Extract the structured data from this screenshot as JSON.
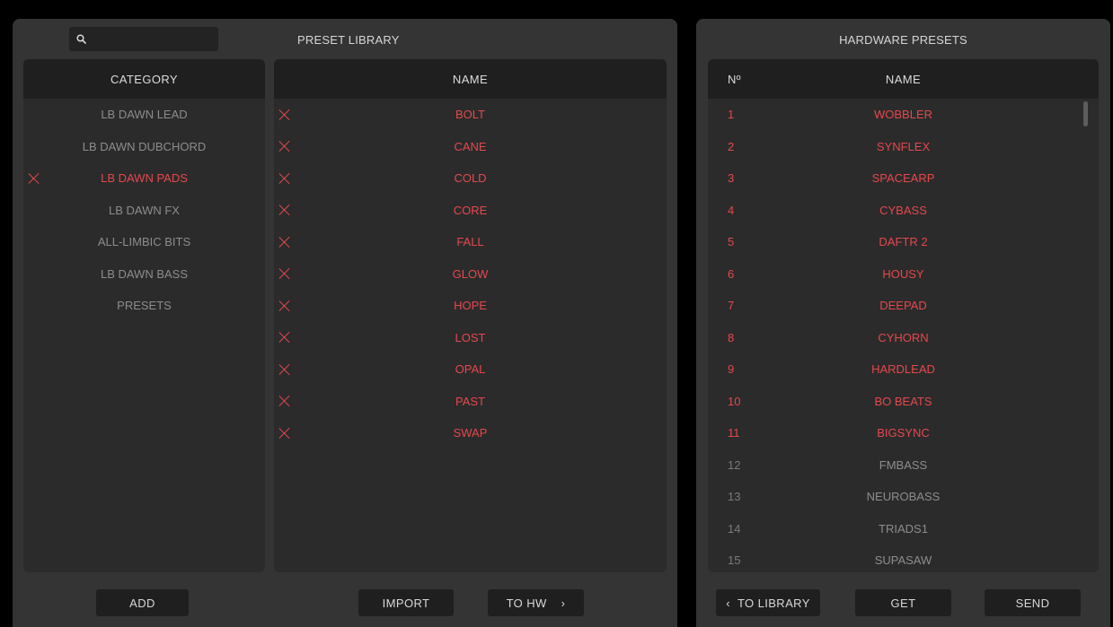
{
  "library": {
    "title": "PRESET LIBRARY",
    "search": {
      "value": "",
      "placeholder": ""
    },
    "category_header": "CATEGORY",
    "name_header": "NAME",
    "categories": [
      {
        "label": "LB DAWN LEAD",
        "selected": false
      },
      {
        "label": "LB DAWN DUBCHORD",
        "selected": false
      },
      {
        "label": "LB DAWN PADS",
        "selected": true
      },
      {
        "label": "LB DAWN FX",
        "selected": false
      },
      {
        "label": "ALL-LIMBIC BITS",
        "selected": false
      },
      {
        "label": "LB DAWN BASS",
        "selected": false
      },
      {
        "label": "PRESETS",
        "selected": false
      }
    ],
    "presets": [
      "BOLT",
      "CANE",
      "COLD",
      "CORE",
      "FALL",
      "GLOW",
      "HOPE",
      "LOST",
      "OPAL",
      "PAST",
      "SWAP"
    ],
    "buttons": {
      "add": "ADD",
      "import": "IMPORT",
      "to_hw": "TO HW"
    }
  },
  "hardware": {
    "title": "HARDWARE PRESETS",
    "num_header": "Nº",
    "name_header": "NAME",
    "presets": [
      {
        "num": "1",
        "name": "WOBBLER",
        "active": true
      },
      {
        "num": "2",
        "name": "SYNFLEX",
        "active": true
      },
      {
        "num": "3",
        "name": "SPACEARP",
        "active": true
      },
      {
        "num": "4",
        "name": "CYBASS",
        "active": true
      },
      {
        "num": "5",
        "name": "DAFTR 2",
        "active": true
      },
      {
        "num": "6",
        "name": "HOUSY",
        "active": true
      },
      {
        "num": "7",
        "name": "DEEPAD",
        "active": true
      },
      {
        "num": "8",
        "name": "CYHORN",
        "active": true
      },
      {
        "num": "9",
        "name": "HARDLEAD",
        "active": true
      },
      {
        "num": "10",
        "name": "BO BEATS",
        "active": true
      },
      {
        "num": "11",
        "name": "BIGSYNC",
        "active": true
      },
      {
        "num": "12",
        "name": "FMBASS",
        "active": false
      },
      {
        "num": "13",
        "name": "NEUROBASS",
        "active": false
      },
      {
        "num": "14",
        "name": "TRIADS1",
        "active": false
      },
      {
        "num": "15",
        "name": "SUPASAW",
        "active": false
      }
    ],
    "buttons": {
      "to_library": "TO LIBRARY",
      "get": "GET",
      "send": "SEND"
    }
  },
  "colors": {
    "accent": "#e5484d",
    "panel": "#343434",
    "list": "#2b2b2b",
    "header": "#1f1f1f"
  }
}
